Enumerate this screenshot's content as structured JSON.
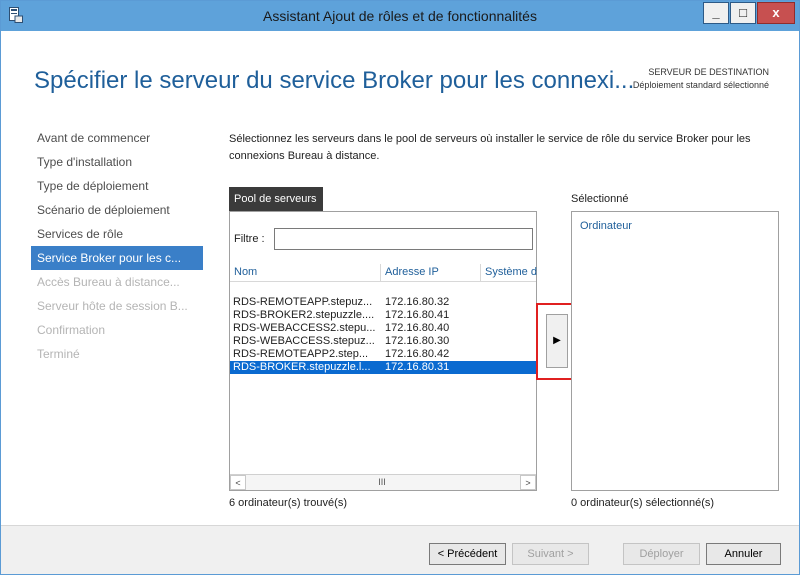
{
  "window": {
    "title": "Assistant Ajout de rôles et de fonctionnalités",
    "minimize_glyph": "_",
    "maximize_glyph": "□",
    "close_glyph": "x"
  },
  "header": {
    "page_title": "Spécifier le serveur du service Broker pour les connexi...",
    "destination_label": "SERVEUR DE DESTINATION",
    "destination_value": "Déploiement standard sélectionné"
  },
  "nav": {
    "items": [
      {
        "label": "Avant de commencer",
        "state": "normal"
      },
      {
        "label": "Type d'installation",
        "state": "normal"
      },
      {
        "label": "Type de déploiement",
        "state": "normal"
      },
      {
        "label": "Scénario de déploiement",
        "state": "normal"
      },
      {
        "label": "Services de rôle",
        "state": "normal"
      },
      {
        "label": "Service Broker pour les c...",
        "state": "active"
      },
      {
        "label": "Accès Bureau à distance...",
        "state": "disabled"
      },
      {
        "label": "Serveur hôte de session B...",
        "state": "disabled"
      },
      {
        "label": "Confirmation",
        "state": "disabled"
      },
      {
        "label": "Terminé",
        "state": "disabled"
      }
    ]
  },
  "main": {
    "description": "Sélectionnez les serveurs dans le pool de serveurs où installer le service de rôle du service Broker pour les connexions Bureau à distance.",
    "pool": {
      "tab_label": "Pool de serveurs",
      "filter_label": "Filtre :",
      "filter_value": "",
      "columns": [
        "Nom",
        "Adresse IP",
        "Système d"
      ],
      "rows": [
        {
          "name": "RDS-REMOTEAPP.stepuz...",
          "ip": "172.16.80.32",
          "selected": false
        },
        {
          "name": "RDS-BROKER2.stepuzzle....",
          "ip": "172.16.80.41",
          "selected": false
        },
        {
          "name": "RDS-WEBACCESS2.stepu...",
          "ip": "172.16.80.40",
          "selected": false
        },
        {
          "name": "RDS-WEBACCESS.stepuz...",
          "ip": "172.16.80.30",
          "selected": false
        },
        {
          "name": "RDS-REMOTEAPP2.step...",
          "ip": "172.16.80.42",
          "selected": false
        },
        {
          "name": "RDS-BROKER.stepuzzle.l...",
          "ip": "172.16.80.31",
          "selected": true
        }
      ],
      "scroll_left": "<",
      "scroll_thumb": "III",
      "scroll_right": ">",
      "count_text": "6 ordinateur(s) trouvé(s)"
    },
    "move_button_glyph": "▶",
    "selected": {
      "label": "Sélectionné",
      "column": "Ordinateur",
      "count_text": "0 ordinateur(s) sélectionné(s)"
    }
  },
  "footer": {
    "prev_label": "< Précédent",
    "next_label": "Suivant >",
    "deploy_label": "Déployer",
    "cancel_label": "Annuler"
  }
}
